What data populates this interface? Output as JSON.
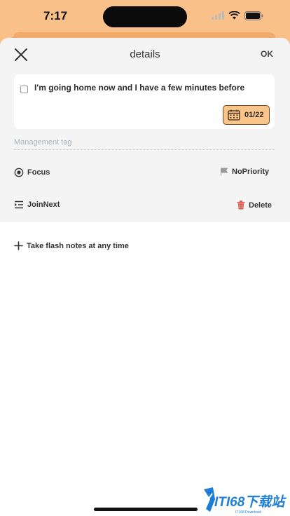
{
  "status_bar": {
    "time": "7:17"
  },
  "header": {
    "title": "details",
    "ok_label": "OK"
  },
  "task": {
    "text": "I'm going home now and I have a few minutes before",
    "date": "01/22"
  },
  "tag_field": {
    "placeholder": "Management tag",
    "value": ""
  },
  "actions": {
    "focus": "Focus",
    "priority": "NoPriority",
    "join_next": "JoinNext",
    "delete": "Delete"
  },
  "flash_note": {
    "label": "Take flash notes at any time"
  },
  "watermark": {
    "text": "ITI68下载站",
    "subtext": "IT168 Download"
  },
  "colors": {
    "accent": "#f9c08a",
    "date_badge": "#fbc48a",
    "delete_red": "#e0554c"
  },
  "icons": {
    "close": "close-icon",
    "calendar": "calendar-icon",
    "focus": "focus-eye-icon",
    "priority": "flag-icon",
    "join_next": "indent-icon",
    "delete": "trash-icon",
    "add": "plus-icon"
  }
}
